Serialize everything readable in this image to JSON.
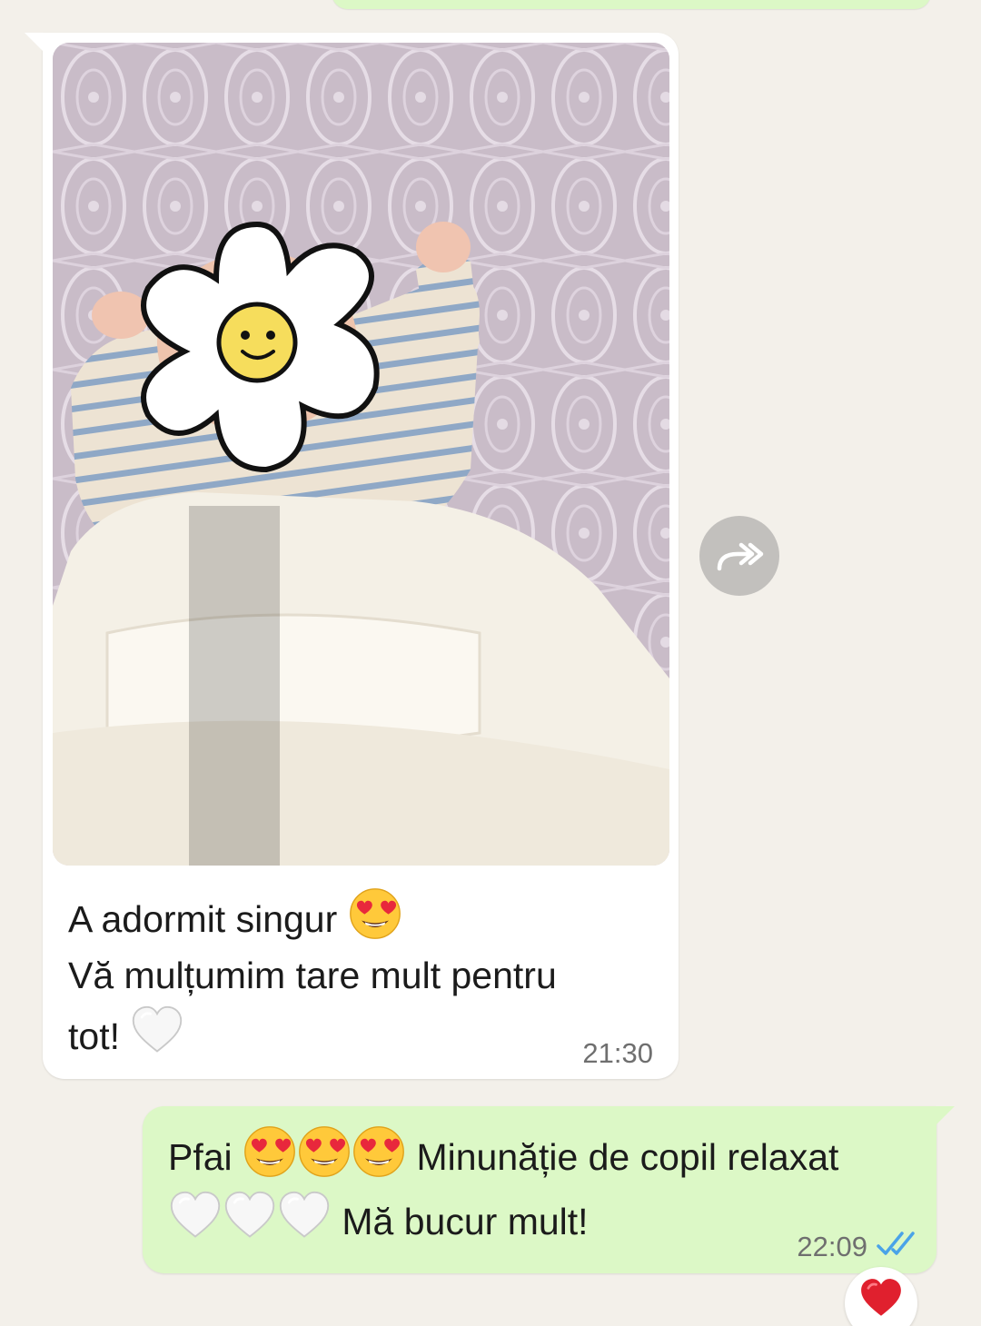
{
  "incoming": {
    "caption_line1": "A adormit singur",
    "caption_line1_emoji": "heart-eyes-emoji",
    "caption_line2": "Vă mulțumim tare mult pentru",
    "caption_line3": "tot!",
    "caption_line3_emoji": "white-heart-emoji",
    "time": "21:30"
  },
  "outgoing": {
    "line1_prefix": "Pfai",
    "line1_emojis": [
      "heart-eyes-emoji",
      "heart-eyes-emoji",
      "heart-eyes-emoji"
    ],
    "line1_suffix": "Minunăție de copil relaxat",
    "line2_emojis": [
      "white-heart-emoji",
      "white-heart-emoji",
      "white-heart-emoji"
    ],
    "line2_text": "Mă bucur mult!",
    "time": "22:09",
    "status_icon": "double-check-read-icon",
    "reaction": "red-heart-emoji"
  },
  "forward_button": {
    "icon": "forward-icon"
  },
  "colors": {
    "chat_background": "#f3f0ea",
    "incoming_bubble": "#ffffff",
    "outgoing_bubble": "#dcf8c6",
    "read_ticks": "#4aa3e8",
    "forward_button": "#c2c0bd"
  }
}
